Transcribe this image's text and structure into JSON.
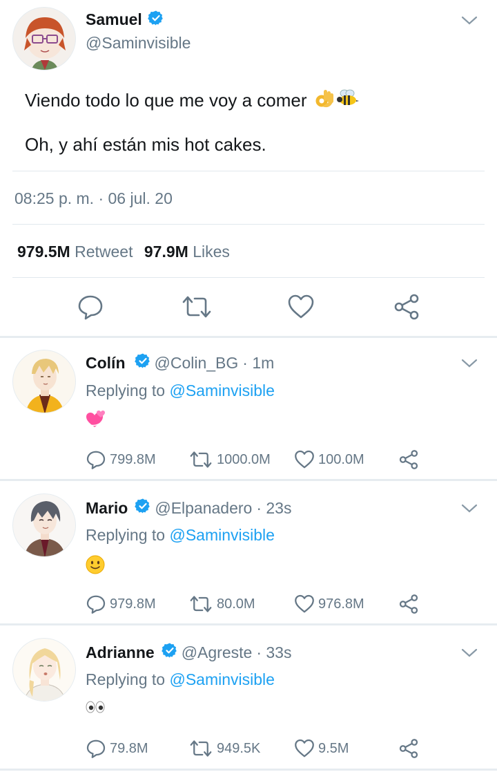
{
  "tweet": {
    "author_name": "Samuel",
    "author_handle": "@Saminvisible",
    "line1": "Viendo todo lo que me voy a comer",
    "line2": "Oh, y ahí están mis hot cakes.",
    "timestamp": "08:25 p. m. · 06 jul. 20",
    "retweets_count": "979.5M",
    "retweets_label": "Retweet",
    "likes_count": "97.9M",
    "likes_label": "Likes"
  },
  "replies": [
    {
      "name": "Colín",
      "handle": "@Colin_BG",
      "time": "· 1m",
      "replying_prefix": "Replying to",
      "replying_handle": "@Saminvisible",
      "emoji": "revolving-hearts",
      "stats": {
        "replies": "799.8M",
        "retweets": "1000.0M",
        "likes": "100.0M"
      }
    },
    {
      "name": "Mario",
      "handle": "@Elpanadero",
      "time": "· 23s",
      "replying_prefix": "Replying to",
      "replying_handle": "@Saminvisible",
      "emoji": "slightly-smiling-face",
      "stats": {
        "replies": "979.8M",
        "retweets": "80.0M",
        "likes": "976.8M"
      }
    },
    {
      "name": "Adrianne",
      "handle": "@Agreste",
      "time": "· 33s",
      "replying_prefix": "Replying to",
      "replying_handle": "@Saminvisible",
      "emoji": "eyes",
      "stats": {
        "replies": "79.8M",
        "retweets": "949.5K",
        "likes": "9.5M"
      }
    }
  ],
  "colors": {
    "verified": "#1da1f2",
    "link": "#1da1f2",
    "secondary_text": "#657786",
    "divider": "#e1e8ed"
  }
}
